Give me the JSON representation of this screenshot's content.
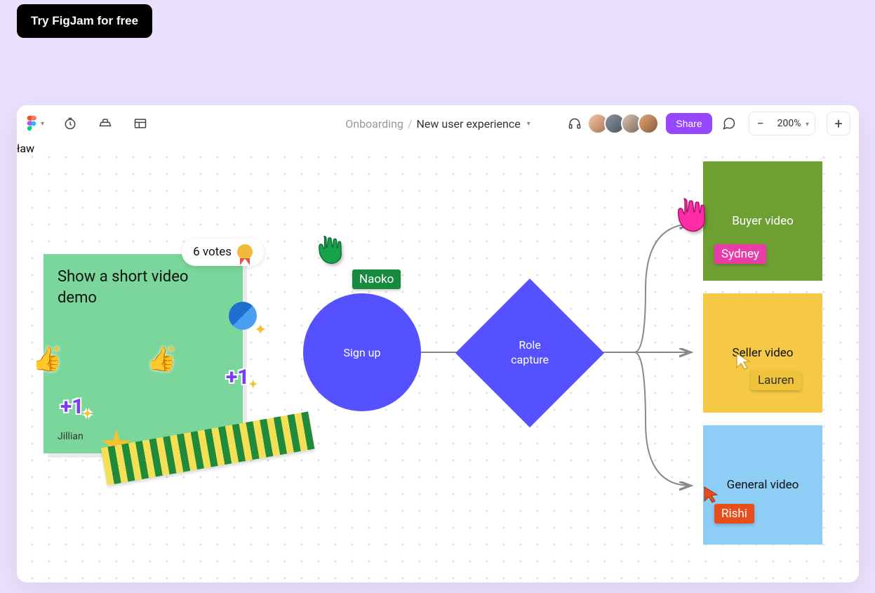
{
  "cta": {
    "label": "Try FigJam for free"
  },
  "breadcrumb": {
    "root": "Onboarding",
    "page": "New user experience"
  },
  "share": {
    "label": "Share"
  },
  "zoom": {
    "value": "200%"
  },
  "sticky": {
    "text": "Show a short video demo",
    "author": "Jillian",
    "votes_label": "6 votes"
  },
  "nodes": {
    "signup": "Sign up",
    "role_capture": "Role\ncapture",
    "cards": {
      "buyer": "Buyer video",
      "seller": "Seller video",
      "general": "General video"
    }
  },
  "cursors": {
    "naoko": "Naoko",
    "sydney": "Sydney",
    "lauren": "Lauren",
    "rishi": "Rishi"
  },
  "colors": {
    "accent": "#9747ff",
    "node_blue": "#5551ff",
    "sticky_green": "#7ad69a"
  }
}
